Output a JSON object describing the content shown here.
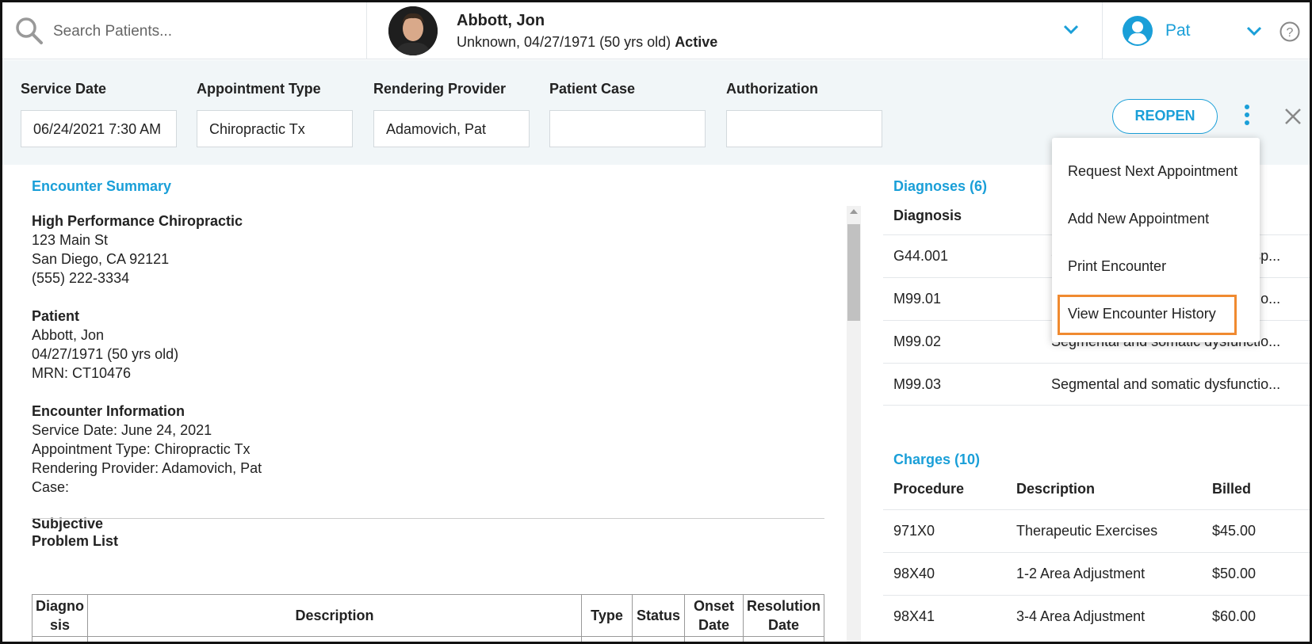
{
  "search": {
    "placeholder": "Search Patients..."
  },
  "patient": {
    "name": "Abbott, Jon",
    "details": "Unknown, 04/27/1971 (50 yrs old)",
    "status": "Active"
  },
  "user": {
    "name": "Pat"
  },
  "header": {
    "fields": [
      {
        "label": "Service Date",
        "value": "06/24/2021 7:30 AM"
      },
      {
        "label": "Appointment Type",
        "value": "Chiropractic Tx"
      },
      {
        "label": "Rendering Provider",
        "value": "Adamovich, Pat"
      },
      {
        "label": "Patient Case",
        "value": ""
      },
      {
        "label": "Authorization",
        "value": ""
      }
    ],
    "reopen_label": "REOPEN"
  },
  "menu": {
    "items": [
      "Request Next Appointment",
      "Add New Appointment",
      "Print Encounter",
      "View Encounter History"
    ],
    "highlighted": "View Encounter History",
    "highlight_color": "#f08a30"
  },
  "summary": {
    "title": "Encounter Summary",
    "practice": {
      "name": "High Performance Chiropractic",
      "street": "123 Main St",
      "city": "San Diego, CA 92121",
      "phone": "(555) 222-3334"
    },
    "patient": {
      "heading": "Patient",
      "name": "Abbott, Jon",
      "dob": "04/27/1971 (50 yrs old)",
      "mrn": "MRN: CT10476"
    },
    "encounter": {
      "heading": "Encounter Information",
      "service_date": "Service Date: June 24, 2021",
      "appointment_type": "Appointment Type: Chiropractic Tx",
      "provider": "Rendering Provider: Adamovich, Pat",
      "case": "Case:"
    },
    "subjective": "Subjective",
    "problem_list": {
      "heading": "Problem List",
      "columns": [
        "Diagno sis",
        "Description",
        "Type",
        "Status",
        "Onset Date",
        "Resolution Date"
      ]
    }
  },
  "diagnoses": {
    "title": "Diagnoses (6)",
    "column": "Diagnosis",
    "rows": [
      {
        "code": "G44.001",
        "desc": "Cluster headache syndrome, unsp..."
      },
      {
        "code": "M99.01",
        "desc": "Segmental and somatic dysfunctio..."
      },
      {
        "code": "M99.02",
        "desc": "Segmental and somatic dysfunctio..."
      },
      {
        "code": "M99.03",
        "desc": "Segmental and somatic dysfunctio..."
      }
    ]
  },
  "charges": {
    "title": "Charges (10)",
    "columns": [
      "Procedure",
      "Description",
      "Billed"
    ],
    "rows": [
      {
        "procedure": "971X0",
        "description": "Therapeutic Exercises",
        "billed": "$45.00"
      },
      {
        "procedure": "98X40",
        "description": "1-2 Area Adjustment",
        "billed": "$50.00"
      },
      {
        "procedure": "98X41",
        "description": "3-4 Area Adjustment",
        "billed": "$60.00"
      }
    ]
  },
  "colors": {
    "accent": "#1a9fd8",
    "header_bg": "#f1f6f8"
  }
}
